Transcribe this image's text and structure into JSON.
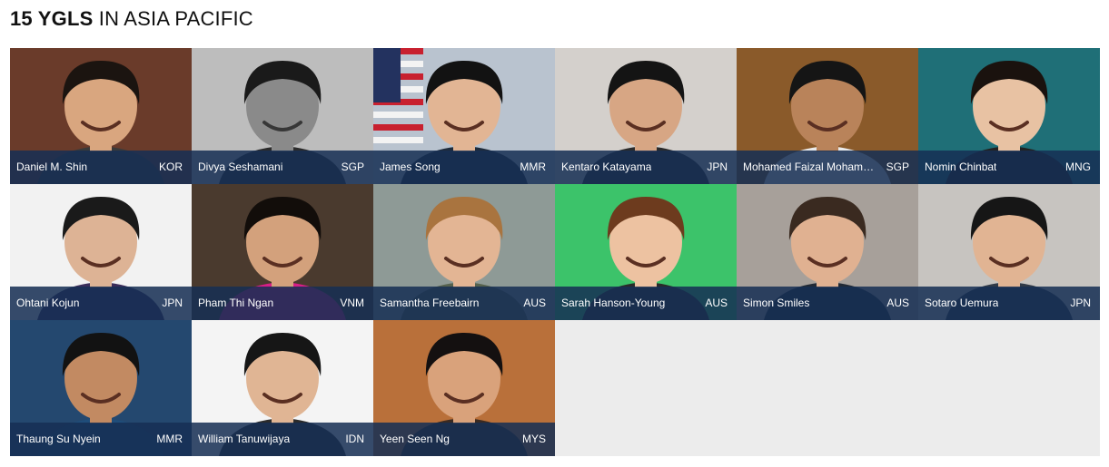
{
  "heading": {
    "count_label": "15 YGLS",
    "region_label": "IN ASIA PACIFIC"
  },
  "people": [
    {
      "name": "Daniel M. Shin",
      "country": "KOR",
      "bg": "#6a3b2a",
      "skin": "#d9a67f",
      "hair": "#1b1410",
      "shirt": "#3a3a3a"
    },
    {
      "name": "Divya Seshamani",
      "country": "SGP",
      "bg": "#bdbdbd",
      "skin": "#8a8a8a",
      "hair": "#1a1a1a",
      "shirt": "#2b2b2b",
      "gray": true
    },
    {
      "name": "James Song",
      "country": "MMR",
      "bg": "#b9c3cf",
      "skin": "#e2b594",
      "hair": "#121212",
      "shirt": "#1e2b3b",
      "flag": true
    },
    {
      "name": "Kentaro Katayama",
      "country": "JPN",
      "bg": "#d4d0cc",
      "skin": "#d7a684",
      "hair": "#141414",
      "shirt": "#2a2a2a"
    },
    {
      "name": "Mohamed Faizal Mohamed Abdul Kadir",
      "country": "SGP",
      "bg": "#8a5a2a",
      "skin": "#b9835a",
      "hair": "#151515",
      "shirt": "#eaeaea"
    },
    {
      "name": "Nomin Chinbat",
      "country": "MNG",
      "bg": "#1f6f77",
      "skin": "#e8c2a3",
      "hair": "#1a120e",
      "shirt": "#222222"
    },
    {
      "name": "Ohtani Kojun",
      "country": "JPN",
      "bg": "#f2f2f2",
      "skin": "#ddb395",
      "hair": "#1a1a1a",
      "shirt": "#3a2d5a"
    },
    {
      "name": "Pham Thi Ngan",
      "country": "VNM",
      "bg": "#4a3a2e",
      "skin": "#d3a17c",
      "hair": "#120d0a",
      "shirt": "#d61f86"
    },
    {
      "name": "Samantha Freebairn",
      "country": "AUS",
      "bg": "#8e9a96",
      "skin": "#e3b594",
      "hair": "#a9743f",
      "shirt": "#56624e"
    },
    {
      "name": "Sarah Hanson-Young",
      "country": "AUS",
      "bg": "#3cc36a",
      "skin": "#edc2a1",
      "hair": "#6d3b1e",
      "shirt": "#2a2a2a"
    },
    {
      "name": "Simon Smiles",
      "country": "AUS",
      "bg": "#a7a09a",
      "skin": "#e0b191",
      "hair": "#3a2a20",
      "shirt": "#222a36"
    },
    {
      "name": "Sotaro Uemura",
      "country": "JPN",
      "bg": "#c7c4c0",
      "skin": "#e1b493",
      "hair": "#161616",
      "shirt": "#303a48"
    },
    {
      "name": "Thaung Su Nyein",
      "country": "MMR",
      "bg": "#24486f",
      "skin": "#c28a62",
      "hair": "#121212",
      "shirt": "#1f4d7a"
    },
    {
      "name": "William Tanuwijaya",
      "country": "IDN",
      "bg": "#f4f4f4",
      "skin": "#e0b594",
      "hair": "#161616",
      "shirt": "#2b2b2b"
    },
    {
      "name": "Yeen Seen Ng",
      "country": "MYS",
      "bg": "#b9703a",
      "skin": "#d9a27b",
      "hair": "#141010",
      "shirt": "#3a2a22"
    }
  ]
}
